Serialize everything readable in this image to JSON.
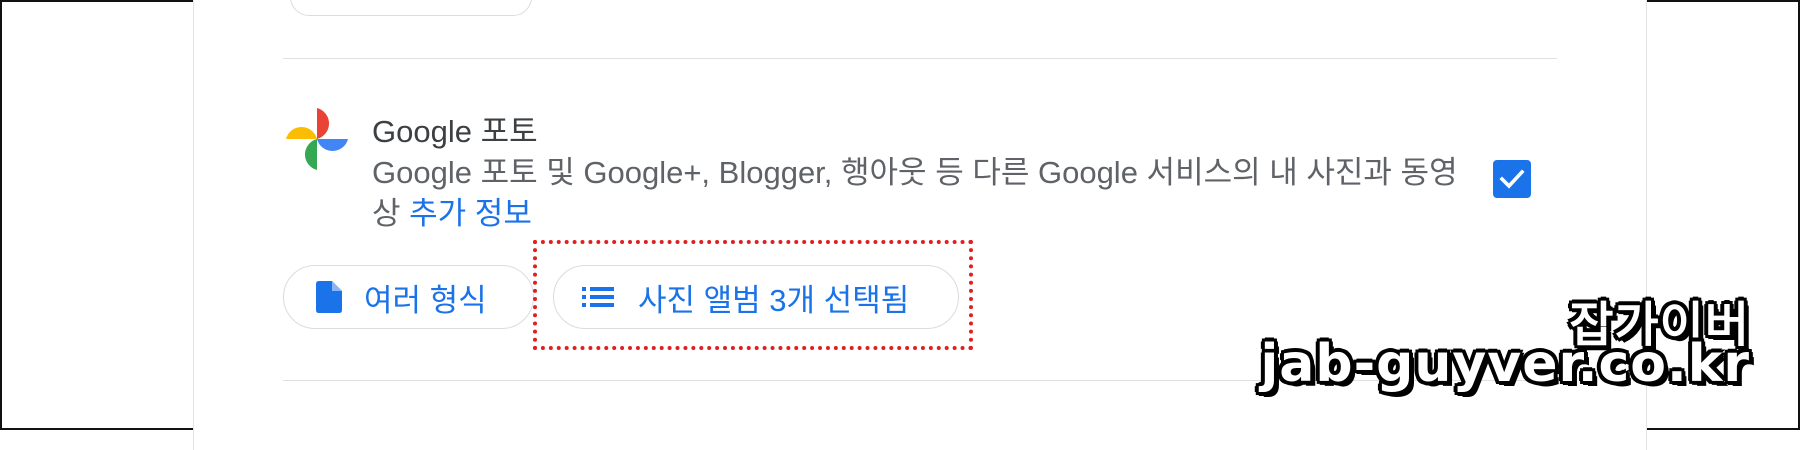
{
  "service": {
    "name": "Google 포토",
    "description_main": "Google 포토 및 Google+, Blogger, 행아웃 등 다른 Google 서비스의 내 사진과 동영상",
    "more_info_link": "추가 정보",
    "checked": true
  },
  "chips": {
    "formats_label": "여러 형식",
    "albums_label": "사진 앨범 3개 선택됨"
  },
  "watermark": {
    "name": "잡가이버",
    "url": "jab-guyver.co.kr"
  },
  "colors": {
    "accent": "#1a73e8",
    "highlight": "#e02020"
  },
  "icons": {
    "logo": "google-photos-logo",
    "formats": "document-icon",
    "albums": "list-icon",
    "checkbox": "check-icon"
  }
}
